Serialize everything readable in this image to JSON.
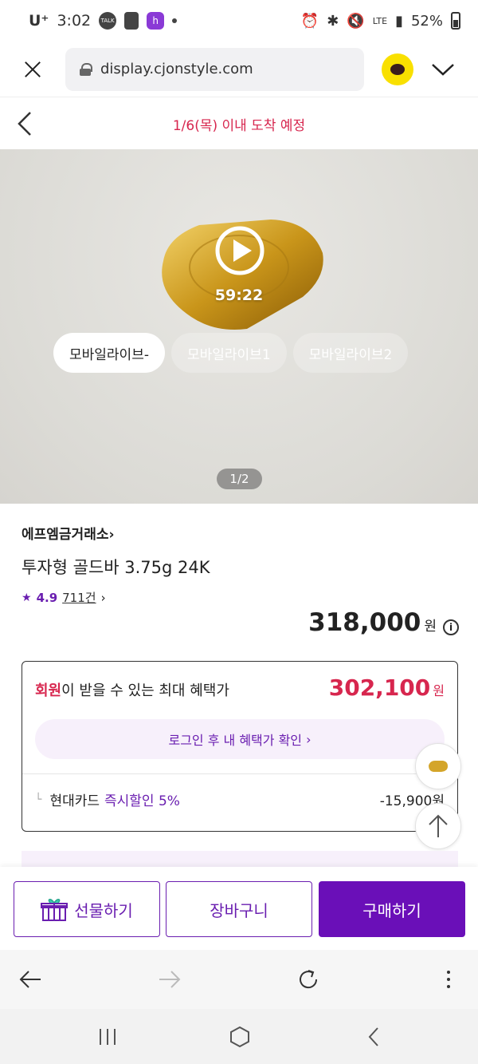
{
  "status_bar": {
    "carrier": "U⁺",
    "time": "3:02",
    "talk_label": "TALK",
    "battery": "52%",
    "network": "LTE"
  },
  "browser": {
    "url": "display.cjonstyle.com"
  },
  "header": {
    "delivery_text": "1/6(목) 이내 도착 예정"
  },
  "hero": {
    "duration": "59:22",
    "live_tabs": [
      "모바일라이브-",
      "모바일라이브1",
      "모바일라이브2"
    ],
    "page_indicator": "1/2"
  },
  "product": {
    "brand": "에프엠금거래소",
    "name": "투자형 골드바 3.75g 24K",
    "rating": "4.9",
    "reviews": "711건",
    "price": "318,000",
    "currency": "원"
  },
  "benefit": {
    "title_highlight": "회원",
    "title_rest": "이 받을 수 있는 최대 혜택가",
    "price": "302,100",
    "currency": "원",
    "login_label": "로그인 후 내 혜택가 확인",
    "card_label": "현대카드",
    "card_accent": "즉시할인 5%",
    "card_amount": "-15,900원"
  },
  "actions": {
    "gift": "선물하기",
    "cart": "장바구니",
    "buy": "구매하기"
  },
  "colors": {
    "accent_purple": "#6a0fb8",
    "accent_red": "#d7264e",
    "kakao_yellow": "#f9e000"
  }
}
